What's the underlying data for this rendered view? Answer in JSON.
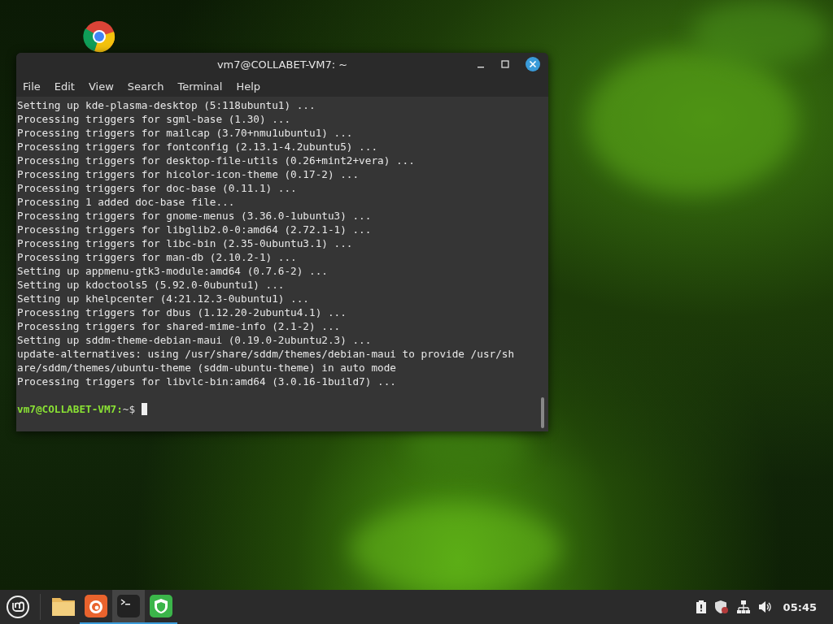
{
  "window": {
    "title": "vm7@COLLABET-VM7: ~",
    "menu": [
      "File",
      "Edit",
      "View",
      "Search",
      "Terminal",
      "Help"
    ]
  },
  "terminal": {
    "lines": [
      "Setting up kde-plasma-desktop (5:118ubuntu1) ...",
      "Processing triggers for sgml-base (1.30) ...",
      "Processing triggers for mailcap (3.70+nmu1ubuntu1) ...",
      "Processing triggers for fontconfig (2.13.1-4.2ubuntu5) ...",
      "Processing triggers for desktop-file-utils (0.26+mint2+vera) ...",
      "Processing triggers for hicolor-icon-theme (0.17-2) ...",
      "Processing triggers for doc-base (0.11.1) ...",
      "Processing 1 added doc-base file...",
      "Processing triggers for gnome-menus (3.36.0-1ubuntu3) ...",
      "Processing triggers for libglib2.0-0:amd64 (2.72.1-1) ...",
      "Processing triggers for libc-bin (2.35-0ubuntu3.1) ...",
      "Processing triggers for man-db (2.10.2-1) ...",
      "Setting up appmenu-gtk3-module:amd64 (0.7.6-2) ...",
      "Setting up kdoctools5 (5.92.0-0ubuntu1) ...",
      "Setting up khelpcenter (4:21.12.3-0ubuntu1) ...",
      "Processing triggers for dbus (1.12.20-2ubuntu4.1) ...",
      "Processing triggers for shared-mime-info (2.1-2) ...",
      "Setting up sddm-theme-debian-maui (0.19.0-2ubuntu2.3) ...",
      "update-alternatives: using /usr/share/sddm/themes/debian-maui to provide /usr/sh",
      "are/sddm/themes/ubuntu-theme (sddm-ubuntu-theme) in auto mode",
      "Processing triggers for libvlc-bin:amd64 (3.0.16-1build7) ..."
    ],
    "prompt": {
      "user_host": "vm7@COLLABET-VM7:",
      "path": "~$"
    }
  },
  "taskbar": {
    "launchers": [
      {
        "kind": "folder",
        "running": false,
        "selected": false
      },
      {
        "kind": "firefox",
        "running": true,
        "selected": false
      },
      {
        "kind": "terminal",
        "running": true,
        "selected": true
      },
      {
        "kind": "shield",
        "running": true,
        "selected": false
      }
    ],
    "clock": "05:45"
  }
}
